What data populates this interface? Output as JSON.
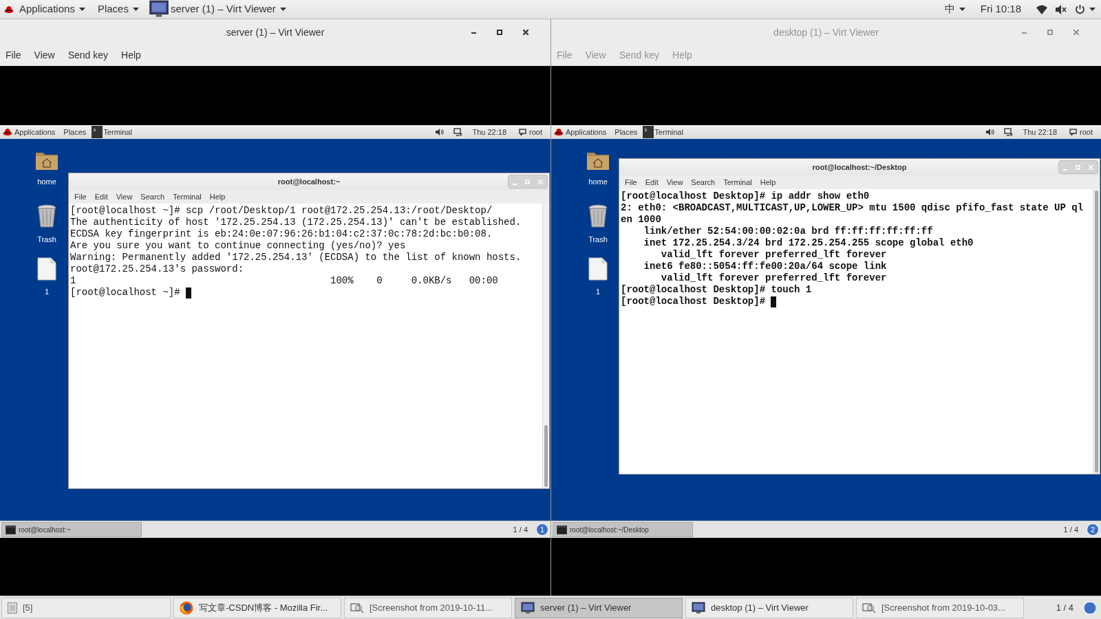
{
  "top_bar": {
    "applications": "Applications",
    "places": "Places",
    "window_list": "server (1) – Virt Viewer",
    "input_method": "中",
    "clock": "Fri 10:18"
  },
  "viewers": [
    {
      "title": "server (1) – Virt Viewer",
      "focused": true,
      "menu": [
        "File",
        "View",
        "Send key",
        "Help"
      ],
      "guest": {
        "panel": {
          "applications": "Applications",
          "places": "Places",
          "window": "Terminal",
          "clock": "Thu 22:18",
          "user": "root"
        },
        "desktop_icons": [
          {
            "kind": "home",
            "label": "home"
          },
          {
            "kind": "trash",
            "label": "Trash"
          },
          {
            "kind": "file",
            "label": "1"
          }
        ],
        "terminal": {
          "title": "root@localhost:~",
          "menu": [
            "File",
            "Edit",
            "View",
            "Search",
            "Terminal",
            "Help"
          ],
          "bold": false,
          "lines": [
            "[root@localhost ~]# scp /root/Desktop/1 root@172.25.254.13:/root/Desktop/",
            "The authenticity of host '172.25.254.13 (172.25.254.13)' can't be established.",
            "ECDSA key fingerprint is eb:24:0e:07:96:26:b1:04:c2:37:0c:78:2d:bc:b0:08.",
            "Are you sure you want to continue connecting (yes/no)? yes",
            "Warning: Permanently added '172.25.254.13' (ECDSA) to the list of known hosts.",
            "root@172.25.254.13's password:",
            "1                                            100%    0     0.0KB/s   00:00"
          ],
          "prompt": "[root@localhost ~]#"
        },
        "bottom_panel": {
          "task": "root@localhost:~",
          "workspace": "1 / 4",
          "badge": "1"
        }
      }
    },
    {
      "title": "desktop (1) – Virt Viewer",
      "focused": false,
      "menu": [
        "File",
        "View",
        "Send key",
        "Help"
      ],
      "guest": {
        "panel": {
          "applications": "Applications",
          "places": "Places",
          "window": "Terminal",
          "clock": "Thu 22:18",
          "user": "root"
        },
        "desktop_icons": [
          {
            "kind": "home",
            "label": "home"
          },
          {
            "kind": "trash",
            "label": "Trash"
          },
          {
            "kind": "file",
            "label": "1"
          }
        ],
        "terminal": {
          "title": "root@localhost:~/Desktop",
          "menu": [
            "File",
            "Edit",
            "View",
            "Search",
            "Terminal",
            "Help"
          ],
          "bold": true,
          "lines": [
            "[root@localhost Desktop]# ip addr show eth0",
            "2: eth0: <BROADCAST,MULTICAST,UP,LOWER_UP> mtu 1500 qdisc pfifo_fast state UP ql",
            "en 1000",
            "    link/ether 52:54:00:00:02:0a brd ff:ff:ff:ff:ff:ff",
            "    inet 172.25.254.3/24 brd 172.25.254.255 scope global eth0",
            "       valid_lft forever preferred_lft forever",
            "    inet6 fe80::5054:ff:fe00:20a/64 scope link",
            "       valid_lft forever preferred_lft forever",
            "[root@localhost Desktop]# touch 1"
          ],
          "prompt": "[root@localhost Desktop]#"
        },
        "bottom_panel": {
          "task": "root@localhost:~/Desktop",
          "workspace": "1 / 4",
          "badge": "2"
        }
      }
    }
  ],
  "taskbar": {
    "items": [
      {
        "kind": "window-list",
        "label": "[5]",
        "selected": false
      },
      {
        "kind": "browser",
        "label": "写文章-CSDN博客 - Mozilla Fir...",
        "selected": false
      },
      {
        "kind": "screenshot",
        "label": "[Screenshot from 2019-10-11...",
        "selected": false
      },
      {
        "kind": "viewer",
        "label": "server (1) – Virt Viewer",
        "selected": true
      },
      {
        "kind": "viewer",
        "label": "desktop (1) – Virt Viewer",
        "selected": false
      },
      {
        "kind": "screenshot",
        "label": "[Screenshot from 2019-10-03...",
        "selected": false
      }
    ],
    "workspace": "1 / 4"
  }
}
